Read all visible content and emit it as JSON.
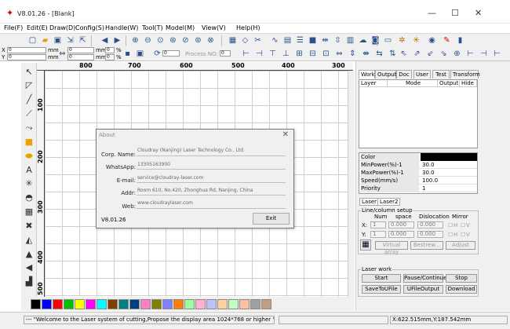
{
  "window": {
    "title": "V8.01.26 - [Blank]",
    "minimize": "—",
    "maximize": "☐",
    "close": "✕"
  },
  "menu": [
    "File(F)",
    "Edit(E)",
    "Draw(D)",
    "Config(S)",
    "Handle(W)",
    "Tool(T)",
    "Model(M)",
    "View(V)",
    "Help(H)"
  ],
  "coords": {
    "x_label": "X",
    "y_label": "Y",
    "x_value": "0",
    "y_value": "0",
    "unit1": "mm",
    "unit2": "mm",
    "w_value": "0",
    "h_value": "0",
    "pct1": "%",
    "pct2": "%",
    "sx": "0",
    "sy": "0",
    "mm3": "mm",
    "mm4": "mm",
    "angle": "0",
    "process_label": "Process NO:",
    "process_value": "0"
  },
  "ruler": {
    "top": [
      "800",
      "700",
      "600",
      "500",
      "400",
      "300"
    ],
    "left": [
      "100",
      "200",
      "300",
      "400",
      "500"
    ]
  },
  "palette": [
    "#000000",
    "#0000ff",
    "#ff0000",
    "#00c000",
    "#ffff00",
    "#ff00ff",
    "#00ffff",
    "#7f3f00",
    "#008080",
    "#004080",
    "#ff80c0",
    "#808000",
    "#8080ff",
    "#ff8000",
    "#9fff9f",
    "#ffb0d0",
    "#c0c0ff",
    "#ffd0a0",
    "#c0ffc0",
    "#ffc0a0",
    "#a0a0a0",
    "#c0a080"
  ],
  "status": {
    "message": "--- \"Welcome to the Laser system of cutting,Propose the display area 1024*768 or higher \"---",
    "coords": "X:622.515mm,Y:187.542mm"
  },
  "tabs": [
    "Work",
    "Output",
    "Doc",
    "User",
    "Test",
    "Transform"
  ],
  "layer_table": {
    "headers": [
      "Layer",
      "Mode",
      "Output",
      "Hide"
    ]
  },
  "props": [
    {
      "k": "Color",
      "v": ""
    },
    {
      "k": "MinPower(%)-1",
      "v": "30.0"
    },
    {
      "k": "MaxPower(%)-1",
      "v": "30.0"
    },
    {
      "k": "Speed(mm/s)",
      "v": "100.0"
    },
    {
      "k": "Priority",
      "v": "1"
    }
  ],
  "laser_tabs": [
    "Laser1",
    "Laser2"
  ],
  "array": {
    "title": "Line/column setup",
    "num": "Num",
    "space": "space",
    "dislocation": "Dislocation",
    "mirror": "Mirror",
    "x": "X:",
    "y": "Y:",
    "xnum": "1",
    "ynum": "1",
    "xspace": "0.000",
    "yspace": "0.000",
    "xdis": "0.000",
    "ydis": "0.000",
    "h": "H",
    "v": "V",
    "virtual": "Virtual array",
    "bestrew": "Bestrew...",
    "adjust": "Adjust"
  },
  "laserwork": {
    "title": "Laser work",
    "start": "Start",
    "pause": "Pause/Continue",
    "stop": "Stop",
    "save": "SaveToUFile",
    "uout": "UFileOutput",
    "download": "Download"
  },
  "about": {
    "title": "About",
    "close": "✕",
    "corp_label": "Corp. Name:",
    "corp": "Cloudray (Nanjing) Laser Technology Co., Ltd.",
    "whatsapp_label": "WhatsApp:",
    "whatsapp": "13305163900",
    "email_label": "E-mail:",
    "email": "service@cloudray-laser.com",
    "addr_label": "Addr:",
    "addr": "Room 610, No.420, Zhonghua Rd, Nanjing, China",
    "web_label": "Web:",
    "web": "www.cloudraylaser.com",
    "version": "V8.01.26",
    "exit": "Exit"
  }
}
